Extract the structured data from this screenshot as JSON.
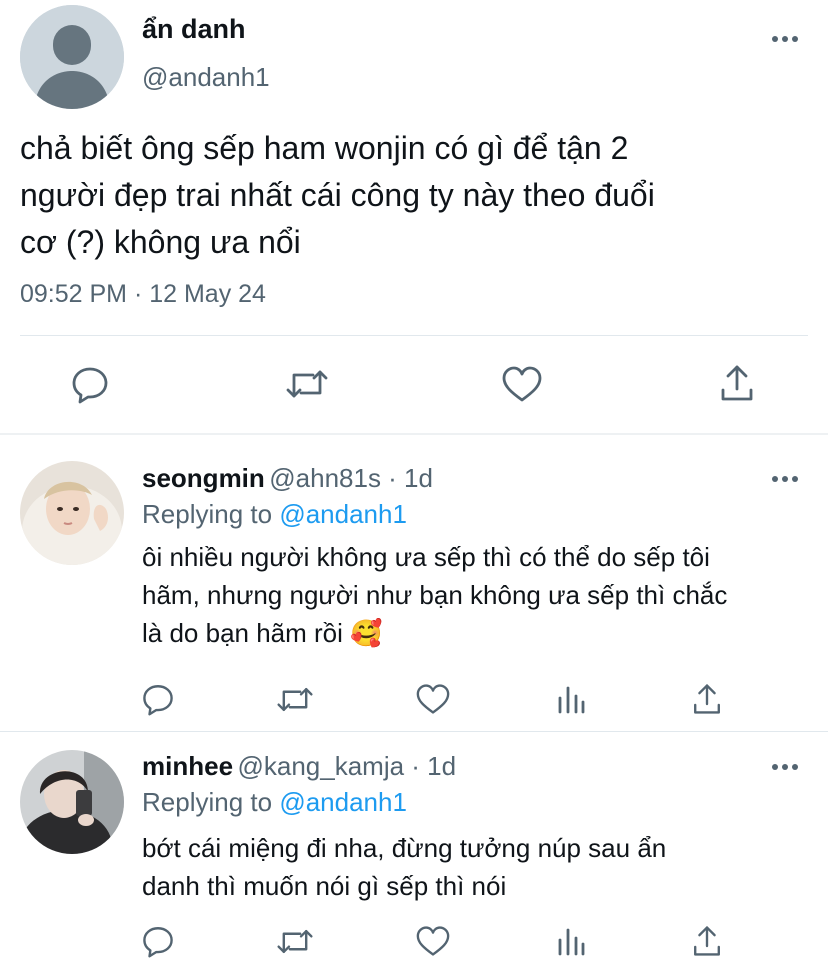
{
  "main_tweet": {
    "display_name": "ẩn danh",
    "handle": "@andanh1",
    "text_lines": [
      "chả biết ông sếp ham wonjin có gì để tận 2",
      "người đẹp trai nhất cái công ty này theo đuổi",
      "cơ (?) không ưa nổi"
    ],
    "timestamp": "09:52 PM · 12 May 24",
    "actions": [
      "reply-icon",
      "retweet-icon",
      "like-icon",
      "share-icon"
    ]
  },
  "replies": [
    {
      "display_name": "seongmin",
      "meta": "@ahn81s · 1d",
      "replying_prefix": "Replying to ",
      "replying_to": "@andanh1",
      "text_lines": [
        "ôi nhiều người không ưa sếp thì có thể do sếp tôi",
        "hãm, nhưng người như bạn không ưa sếp thì chắc",
        "là do bạn hãm rồi"
      ],
      "emoji": "🥰",
      "actions": [
        "reply-icon",
        "retweet-icon",
        "like-icon",
        "analytics-icon",
        "share-icon"
      ]
    },
    {
      "display_name": "minhee",
      "meta": "@kang_kamja · 1d",
      "replying_prefix": "Replying to ",
      "replying_to": "@andanh1",
      "text_lines": [
        "bớt cái miệng đi nha, đừng tưởng núp sau ẩn",
        "danh thì muốn nói gì sếp thì nói"
      ],
      "actions": [
        "reply-icon",
        "retweet-icon",
        "like-icon",
        "analytics-icon",
        "share-icon"
      ]
    }
  ],
  "colors": {
    "text_primary": "#0f1419",
    "text_secondary": "#536471",
    "mention_blue": "#1d9bf0",
    "divider": "#e1e8ed",
    "avatar_placeholder": "#ccd6dd"
  }
}
